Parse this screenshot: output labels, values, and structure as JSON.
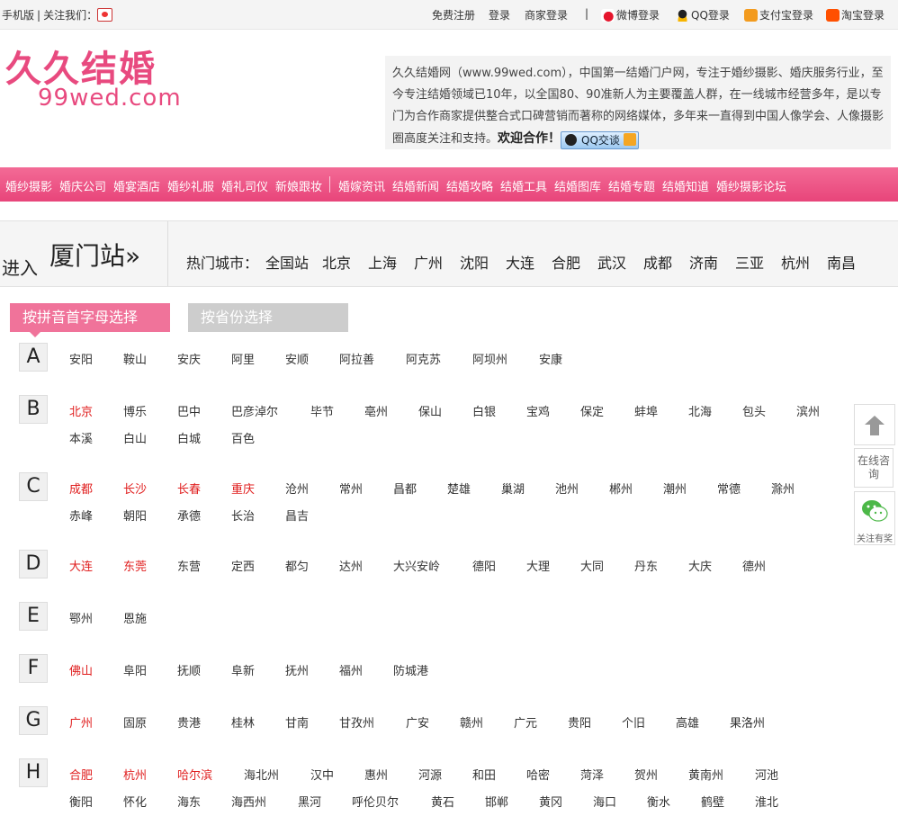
{
  "topbar": {
    "mobile": "手机版",
    "follow": "关注我们：",
    "register": "免费注册",
    "login": "登录",
    "merchant_login": "商家登录",
    "weibo_login": "微博登录",
    "qq_login": "QQ登录",
    "alipay_login": "支付宝登录",
    "taobao_login": "淘宝登录"
  },
  "header": {
    "logo_cn": "久久结婚",
    "logo_en": "99wed.com",
    "intro_text": "久久结婚网（www.99wed.com），中国第一结婚门户网，专注于婚纱摄影、婚庆服务行业，至今专注结婚领域已10年，以全国80、90准新人为主要覆盖人群，在一线城市经营多年，是以专门为合作商家提供整合式口碑营销而著称的网络媒体，多年来一直得到中国人像学会、人像摄影圈高度关注和支持。",
    "welcome": "欢迎合作！",
    "qq_chat": "QQ交谈"
  },
  "nav": [
    "婚纱摄影",
    "婚庆公司",
    "婚宴酒店",
    "婚纱礼服",
    "婚礼司仪",
    "新娘跟妆",
    "婚嫁资讯",
    "结婚新闻",
    "结婚攻略",
    "结婚工具",
    "结婚图库",
    "结婚专题",
    "结婚知道",
    "婚纱摄影论坛"
  ],
  "citybar": {
    "enter": "进入",
    "station": "厦门站»",
    "hot_label": "热门城市：",
    "hot_cities": [
      "全国站",
      "北京",
      "上海",
      "广州",
      "沈阳",
      "大连",
      "合肥",
      "武汉",
      "成都",
      "济南",
      "三亚",
      "杭州",
      "南昌"
    ]
  },
  "tabs": {
    "pinyin": "按拼音首字母选择",
    "province": "按省份选择"
  },
  "letters": [
    {
      "letter": "A",
      "rows": [
        [
          {
            "n": "安阳",
            "h": false
          },
          {
            "n": "鞍山",
            "h": false
          },
          {
            "n": "安庆",
            "h": false
          },
          {
            "n": "阿里",
            "h": false
          },
          {
            "n": "安顺",
            "h": false
          },
          {
            "n": "阿拉善",
            "h": false
          },
          {
            "n": "阿克苏",
            "h": false
          },
          {
            "n": "阿坝州",
            "h": false
          },
          {
            "n": "安康",
            "h": false
          }
        ]
      ]
    },
    {
      "letter": "B",
      "rows": [
        [
          {
            "n": "北京",
            "h": true
          },
          {
            "n": "博乐",
            "h": false
          },
          {
            "n": "巴中",
            "h": false
          },
          {
            "n": "巴彦淖尔",
            "h": false
          },
          {
            "n": "毕节",
            "h": false
          },
          {
            "n": "亳州",
            "h": false
          },
          {
            "n": "保山",
            "h": false
          },
          {
            "n": "白银",
            "h": false
          },
          {
            "n": "宝鸡",
            "h": false
          },
          {
            "n": "保定",
            "h": false
          },
          {
            "n": "蚌埠",
            "h": false
          },
          {
            "n": "北海",
            "h": false
          },
          {
            "n": "包头",
            "h": false
          },
          {
            "n": "滨州",
            "h": false
          }
        ],
        [
          {
            "n": "本溪",
            "h": false
          },
          {
            "n": "白山",
            "h": false
          },
          {
            "n": "白城",
            "h": false
          },
          {
            "n": "百色",
            "h": false
          }
        ]
      ]
    },
    {
      "letter": "C",
      "rows": [
        [
          {
            "n": "成都",
            "h": true
          },
          {
            "n": "长沙",
            "h": true
          },
          {
            "n": "长春",
            "h": true
          },
          {
            "n": "重庆",
            "h": true
          },
          {
            "n": "沧州",
            "h": false
          },
          {
            "n": "常州",
            "h": false
          },
          {
            "n": "昌都",
            "h": false
          },
          {
            "n": "楚雄",
            "h": false
          },
          {
            "n": "巢湖",
            "h": false
          },
          {
            "n": "池州",
            "h": false
          },
          {
            "n": "郴州",
            "h": false
          },
          {
            "n": "潮州",
            "h": false
          },
          {
            "n": "常德",
            "h": false
          },
          {
            "n": "滁州",
            "h": false
          }
        ],
        [
          {
            "n": "赤峰",
            "h": false
          },
          {
            "n": "朝阳",
            "h": false
          },
          {
            "n": "承德",
            "h": false
          },
          {
            "n": "长治",
            "h": false
          },
          {
            "n": "昌吉",
            "h": false
          }
        ]
      ]
    },
    {
      "letter": "D",
      "rows": [
        [
          {
            "n": "大连",
            "h": true
          },
          {
            "n": "东莞",
            "h": true
          },
          {
            "n": "东营",
            "h": false
          },
          {
            "n": "定西",
            "h": false
          },
          {
            "n": "都匀",
            "h": false
          },
          {
            "n": "达州",
            "h": false
          },
          {
            "n": "大兴安岭",
            "h": false
          },
          {
            "n": "德阳",
            "h": false
          },
          {
            "n": "大理",
            "h": false
          },
          {
            "n": "大同",
            "h": false
          },
          {
            "n": "丹东",
            "h": false
          },
          {
            "n": "大庆",
            "h": false
          },
          {
            "n": "德州",
            "h": false
          }
        ]
      ]
    },
    {
      "letter": "E",
      "rows": [
        [
          {
            "n": "鄂州",
            "h": false
          },
          {
            "n": "恩施",
            "h": false
          }
        ]
      ]
    },
    {
      "letter": "F",
      "rows": [
        [
          {
            "n": "佛山",
            "h": true
          },
          {
            "n": "阜阳",
            "h": false
          },
          {
            "n": "抚顺",
            "h": false
          },
          {
            "n": "阜新",
            "h": false
          },
          {
            "n": "抚州",
            "h": false
          },
          {
            "n": "福州",
            "h": false
          },
          {
            "n": "防城港",
            "h": false
          }
        ]
      ]
    },
    {
      "letter": "G",
      "rows": [
        [
          {
            "n": "广州",
            "h": true
          },
          {
            "n": "固原",
            "h": false
          },
          {
            "n": "贵港",
            "h": false
          },
          {
            "n": "桂林",
            "h": false
          },
          {
            "n": "甘南",
            "h": false
          },
          {
            "n": "甘孜州",
            "h": false
          },
          {
            "n": "广安",
            "h": false
          },
          {
            "n": "赣州",
            "h": false
          },
          {
            "n": "广元",
            "h": false
          },
          {
            "n": "贵阳",
            "h": false
          },
          {
            "n": "个旧",
            "h": false
          },
          {
            "n": "高雄",
            "h": false
          },
          {
            "n": "果洛州",
            "h": false
          }
        ]
      ]
    },
    {
      "letter": "H",
      "rows": [
        [
          {
            "n": "合肥",
            "h": true
          },
          {
            "n": "杭州",
            "h": true
          },
          {
            "n": "哈尔滨",
            "h": true
          },
          {
            "n": "海北州",
            "h": false
          },
          {
            "n": "汉中",
            "h": false
          },
          {
            "n": "惠州",
            "h": false
          },
          {
            "n": "河源",
            "h": false
          },
          {
            "n": "和田",
            "h": false
          },
          {
            "n": "哈密",
            "h": false
          },
          {
            "n": "菏泽",
            "h": false
          },
          {
            "n": "贺州",
            "h": false
          },
          {
            "n": "黄南州",
            "h": false
          },
          {
            "n": "河池",
            "h": false
          }
        ],
        [
          {
            "n": "衡阳",
            "h": false
          },
          {
            "n": "怀化",
            "h": false
          },
          {
            "n": "海东",
            "h": false
          },
          {
            "n": "海西州",
            "h": false
          },
          {
            "n": "黑河",
            "h": false
          },
          {
            "n": "呼伦贝尔",
            "h": false
          },
          {
            "n": "黄石",
            "h": false
          },
          {
            "n": "邯郸",
            "h": false
          },
          {
            "n": "黄冈",
            "h": false
          },
          {
            "n": "海口",
            "h": false
          },
          {
            "n": "衡水",
            "h": false
          },
          {
            "n": "鹤壁",
            "h": false
          },
          {
            "n": "淮北",
            "h": false
          }
        ]
      ]
    }
  ],
  "float": {
    "consult": "在线咨询",
    "wechat": "关注有奖"
  }
}
